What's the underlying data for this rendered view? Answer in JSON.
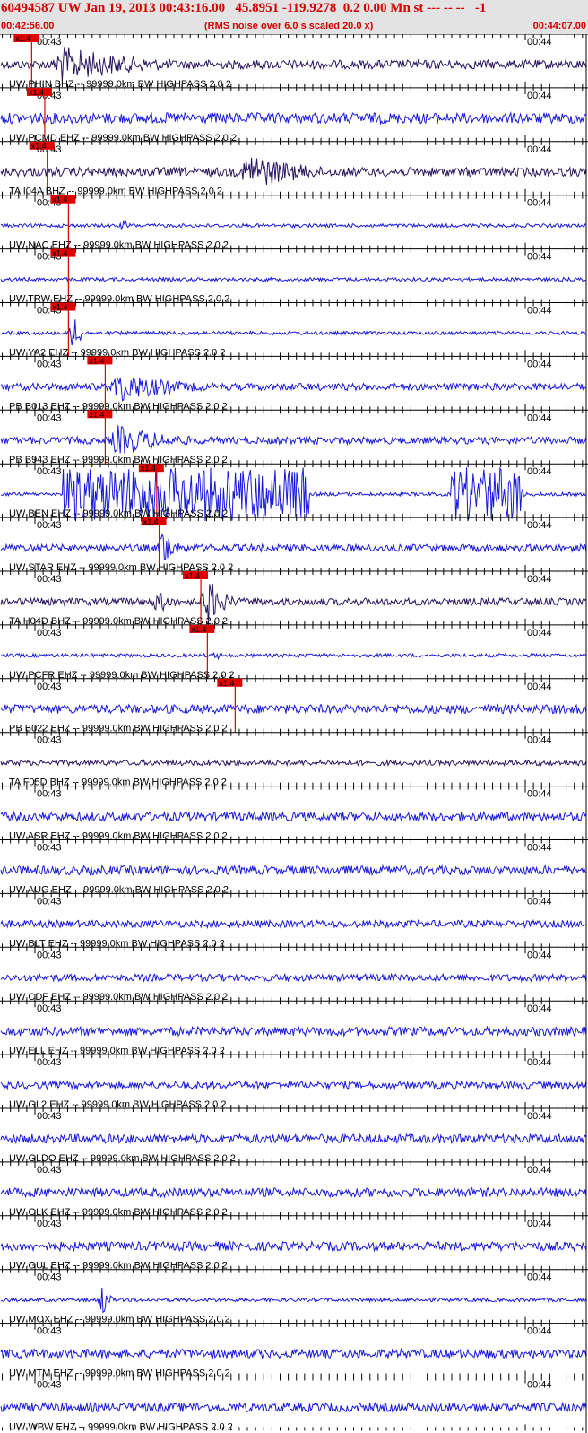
{
  "header": {
    "title": "60494587 UW Jan 19, 2013 00:43:16.00   45.8951 -119.9278  0.2 0.00 Mn st --- -- --   -1",
    "start_time": "00:42:56.00",
    "note": "(RMS noise over 6.0 s scaled 20.0 x)",
    "end_time": "00:44:07.00"
  },
  "colors": {
    "trace": "#1818e0",
    "trace_dark": "#2a1560",
    "pick": "#e00000",
    "text": "#000000",
    "header": "#d40000",
    "header_bg": "#e3e3e3"
  },
  "chart_data": {
    "type": "seismogram",
    "x_start": "00:42:56.00",
    "x_end": "00:44:07.00",
    "x_range_seconds": [
      0,
      71
    ],
    "tick_interval_seconds": 1,
    "pick_label": "x1.4",
    "tick_labels": [
      "00:43",
      "00:44"
    ],
    "traces": [
      {
        "name": "UW PHIN BHZ -- 99999.0km BW  HIGHPASS  2.0  2",
        "dark": true,
        "amp": 5,
        "events": [
          {
            "t": 6,
            "dur": 28,
            "amp": 22
          }
        ],
        "pick_s": 3.6,
        "clipped": false
      },
      {
        "name": "UW PCMD EHZ -- 99999.0km BW  HIGHPASS  2.0  2",
        "dark": false,
        "amp": 6,
        "events": [],
        "pick_s": 5.2,
        "clipped": false
      },
      {
        "name": "TA I04A BHZ -- 99999.0km BW  HIGHPASS  2.0  2",
        "dark": true,
        "amp": 5,
        "events": [
          {
            "t": 29,
            "dur": 20,
            "amp": 22
          }
        ],
        "pick_s": 5.5,
        "clipped": false
      },
      {
        "name": "UW NAC EHZ -- 99999.0km BW  HIGHPASS  2.0  2",
        "dark": false,
        "amp": 2,
        "events": [
          {
            "t": 14,
            "dur": 3,
            "amp": 6
          }
        ],
        "pick_s": 8.1,
        "clipped": false
      },
      {
        "name": "UW TRW EHZ -- 99999.0km BW  HIGHPASS  2.0  2",
        "dark": false,
        "amp": 2,
        "events": [],
        "pick_s": 8.1,
        "clipped": false
      },
      {
        "name": "UW YA2 EHZ -- 99999.0km BW  HIGHPASS  2.0  2",
        "dark": false,
        "amp": 2,
        "events": [
          {
            "t": 8,
            "dur": 1.5,
            "amp": 28
          }
        ],
        "pick_s": 8.1,
        "clipped": false
      },
      {
        "name": "PB B013 EHZ -- 99999.0km BW  HIGHPASS  2.0  2",
        "dark": false,
        "amp": 4,
        "events": [
          {
            "t": 13,
            "dur": 22,
            "amp": 18
          }
        ],
        "pick_s": 12.6,
        "clipped": false
      },
      {
        "name": "PB B943 EHZ -- 99999.0km BW  HIGHPASS  2.0  2",
        "dark": false,
        "amp": 4,
        "events": [
          {
            "t": 13,
            "dur": 20,
            "amp": 18
          }
        ],
        "pick_s": 12.6,
        "clipped": false
      },
      {
        "name": "UW BEN EHZ -- 99999.0km BW  HIGHPASS  2.0  2",
        "dark": false,
        "amp": 2,
        "events": [],
        "pick_s": 18.9,
        "clipped": true
      },
      {
        "name": "UW STAR EHZ -- 99999.0km BW  HIGHPASS  2.0  2",
        "dark": false,
        "amp": 4,
        "events": [
          {
            "t": 18.9,
            "dur": 3,
            "amp": 28
          }
        ],
        "pick_s": 19.2,
        "clipped": false
      },
      {
        "name": "TA H04D BHZ -- 99999.0km BW  HIGHPASS  2.0  2",
        "dark": true,
        "amp": 4,
        "events": [
          {
            "t": 18,
            "dur": 6,
            "amp": 14
          },
          {
            "t": 24,
            "dur": 6,
            "amp": 30
          }
        ],
        "pick_s": 24.3,
        "clipped": false
      },
      {
        "name": "UW PCFR EHZ -- 99999.0km BW  HIGHPASS  2.0  2",
        "dark": false,
        "amp": 2,
        "events": [
          {
            "t": 25.2,
            "dur": 3,
            "amp": 5
          }
        ],
        "pick_s": 25.1,
        "clipped": false
      },
      {
        "name": "PB B022 EHZ -- 99999.0km BW  HIGHPASS  2.0  2",
        "dark": false,
        "amp": 5,
        "events": [],
        "pick_s": 28.5,
        "clipped": false
      },
      {
        "name": "TA F05D BHZ -- 99999.0km BW  HIGHPASS  2.0  2",
        "dark": true,
        "amp": 3,
        "events": [],
        "pick_s": null,
        "clipped": false
      },
      {
        "name": "UW ASR EHZ -- 99999.0km BW  HIGHPASS  2.0  2",
        "dark": false,
        "amp": 5,
        "events": [],
        "pick_s": null,
        "clipped": false
      },
      {
        "name": "UW AUG EHZ -- 99999.0km BW  HIGHPASS  2.0  2",
        "dark": false,
        "amp": 5,
        "events": [],
        "pick_s": null,
        "clipped": false
      },
      {
        "name": "UW BLT EHZ -- 99999.0km BW  HIGHPASS  2.0  2",
        "dark": false,
        "amp": 4,
        "events": [],
        "pick_s": null,
        "clipped": false
      },
      {
        "name": "UW CDF EHZ -- 99999.0km BW  HIGHPASS  2.0  2",
        "dark": false,
        "amp": 4,
        "events": [],
        "pick_s": null,
        "clipped": false
      },
      {
        "name": "UW ELL EHZ -- 99999.0km BW  HIGHPASS  2.0  2",
        "dark": false,
        "amp": 5,
        "events": [],
        "pick_s": null,
        "clipped": false
      },
      {
        "name": "UW GL2 EHZ -- 99999.0km BW  HIGHPASS  2.0  2",
        "dark": false,
        "amp": 4,
        "events": [],
        "pick_s": null,
        "clipped": false
      },
      {
        "name": "UW GLDO EHZ -- 99999.0km BW  HIGHPASS  2.0  2",
        "dark": false,
        "amp": 5,
        "events": [],
        "pick_s": null,
        "clipped": false
      },
      {
        "name": "UW GLK EHZ -- 99999.0km BW  HIGHPASS  2.0  2",
        "dark": false,
        "amp": 5,
        "events": [],
        "pick_s": null,
        "clipped": false
      },
      {
        "name": "UW GUL EHZ -- 99999.0km BW  HIGHPASS  2.0  2",
        "dark": false,
        "amp": 5,
        "events": [],
        "pick_s": null,
        "clipped": false
      },
      {
        "name": "UW MOX EHZ -- 99999.0km BW  HIGHPASS  2.0  2",
        "dark": false,
        "amp": 2,
        "events": [
          {
            "t": 11.5,
            "dur": 1.5,
            "amp": 22
          }
        ],
        "pick_s": null,
        "clipped": false
      },
      {
        "name": "UW MTM EHZ -- 99999.0km BW  HIGHPASS  2.0  2",
        "dark": false,
        "amp": 5,
        "events": [],
        "pick_s": null,
        "clipped": false
      },
      {
        "name": "UW WPW EHZ -- 99999.0km BW  HIGHPASS  2.0  2",
        "dark": false,
        "amp": 5,
        "events": [],
        "pick_s": null,
        "clipped": false
      }
    ]
  }
}
